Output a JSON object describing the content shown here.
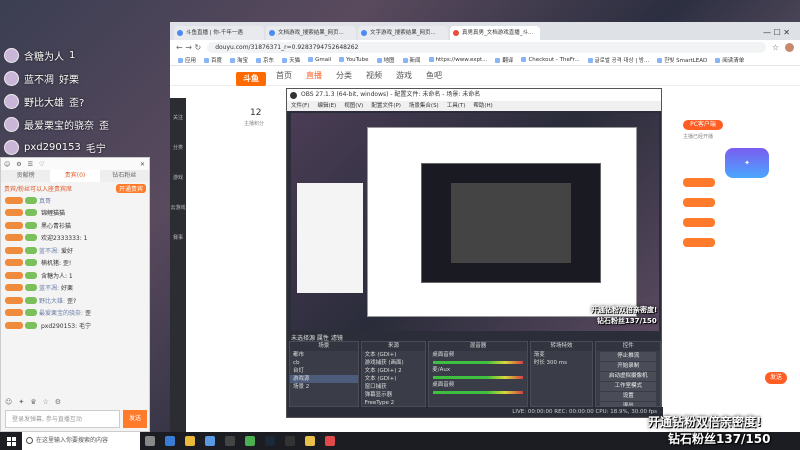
{
  "overlay_chat": [
    {
      "name": "含糖为人",
      "text": "1"
    },
    {
      "name": "蓝不凋",
      "text": "好栗"
    },
    {
      "name": "野比大雄",
      "text": "歪?"
    },
    {
      "name": "最爱栗宝的骁奈",
      "text": "歪"
    },
    {
      "name": "pxd290153",
      "text": "毛宁"
    }
  ],
  "left_chat": {
    "tabs": [
      "贡献榜",
      "贵宾(0)",
      "钻石粉丝"
    ],
    "notice": "贵宾/粉丝可以入座贵宾席",
    "notice_btn": "开通贵宾",
    "rows": [
      {
        "name": "真哥",
        "text": ""
      },
      {
        "name": "",
        "text": "锦鲤猫猫"
      },
      {
        "name": "",
        "text": "黑心青衫猫"
      },
      {
        "name": "",
        "text": "欢迎2333333: 1"
      },
      {
        "name": "蓝不凋:",
        "text": "爱好"
      },
      {
        "name": "",
        "text": "楠机猪: 歪!"
      },
      {
        "name": "",
        "text": "含糖为人: 1"
      },
      {
        "name": "蓝不凋:",
        "text": "好栗"
      },
      {
        "name": "野比大雄:",
        "text": "歪?"
      },
      {
        "name": "最爱栗宝的骁奈:",
        "text": "歪"
      },
      {
        "name": "",
        "text": "pxd290153: 毛宁"
      }
    ],
    "input_placeholder": "登录发弹幕, 参与直播互动",
    "send_label": "发送"
  },
  "browser": {
    "tabs": [
      "斗鱼直播 | 你-千年一遇",
      "文档游戏_搜索结果_网页...",
      "文字游戏_搜索结果_网页...",
      "真男真男_文档游戏直播_斗..."
    ],
    "url": "douyu.com/31876371_r=0.9283794752648262",
    "bookmarks": [
      "应用",
      "百度",
      "淘宝",
      "京东",
      "天猫",
      "Gmail",
      "YouTube",
      "地图",
      "新闻",
      "https://www.expt...",
      "翻译",
      "Checkout - TheFr...",
      "글로벌 공격 대상 | 방...",
      "한빛 SmartLEAD",
      "阅读清单"
    ],
    "site_nav": [
      "首页",
      "直播",
      "分类",
      "视频",
      "游戏",
      "鱼吧"
    ],
    "site_nav_active": 1,
    "logo": "斗鱼",
    "side": [
      "关注",
      "分类",
      "游戏",
      "云游戏",
      "赛事"
    ],
    "counter": "12",
    "counter_label": "主播积分",
    "pc_button": "PC客户端",
    "pc_sub": "主播已经开播",
    "send_btn": "发送",
    "nav_controls": "←  →  ↻",
    "window_controls": "—  ☐  ✕"
  },
  "obs": {
    "title": "OBS 27.1.3 (64-bit, windows) - 配置文件: 未命名 - 场景: 未命名",
    "menu": [
      "文件(F)",
      "编辑(E)",
      "视图(V)",
      "配置文件(P)",
      "场景集合(S)",
      "工具(T)",
      "帮助(H)"
    ],
    "source_bar": "未选择源    属性  滤镜",
    "docks": {
      "scenes": {
        "title": "场景",
        "items": [
          "都市",
          "cb",
          "台灯",
          "游戏源",
          "场景 2"
        ],
        "selected": 3
      },
      "sources": {
        "title": "来源",
        "items": [
          "文本 (GDI+)",
          "游戏捕获 (画面)",
          "文本 (GDI+) 2",
          "文本 (GDI+)",
          "窗口捕获",
          "弹幕显示器",
          "FreeType 2"
        ]
      },
      "mixer": {
        "title": "混音器",
        "items": [
          "桌面音频",
          "麦/Aux",
          "桌面音频"
        ]
      },
      "transitions": {
        "title": "转场特效",
        "items": [
          "渐变",
          "时长  300 ms"
        ]
      },
      "controls": {
        "title": "控件",
        "buttons": [
          "停止推流",
          "开始录制",
          "启动虚拟摄像机",
          "工作室模式",
          "设置",
          "退出"
        ]
      }
    },
    "status": "LIVE: 00:00:00   REC: 00:00:00   CPU: 18.9%, 30.00 fps"
  },
  "banner": {
    "line1": "开通钻粉双倍亲密度!",
    "line2": "钻石粉丝137/150"
  },
  "taskbar": {
    "search_placeholder": "在这里输入你要搜索的内容",
    "icons": [
      "task-view",
      "edge",
      "explorer",
      "store",
      "obs",
      "chrome",
      "steam",
      "terminal",
      "folder",
      "media"
    ]
  },
  "colors": {
    "douyu_orange": "#ff5d23",
    "obs_bg": "#2b2e38",
    "desktop": "#2a2d3a"
  }
}
